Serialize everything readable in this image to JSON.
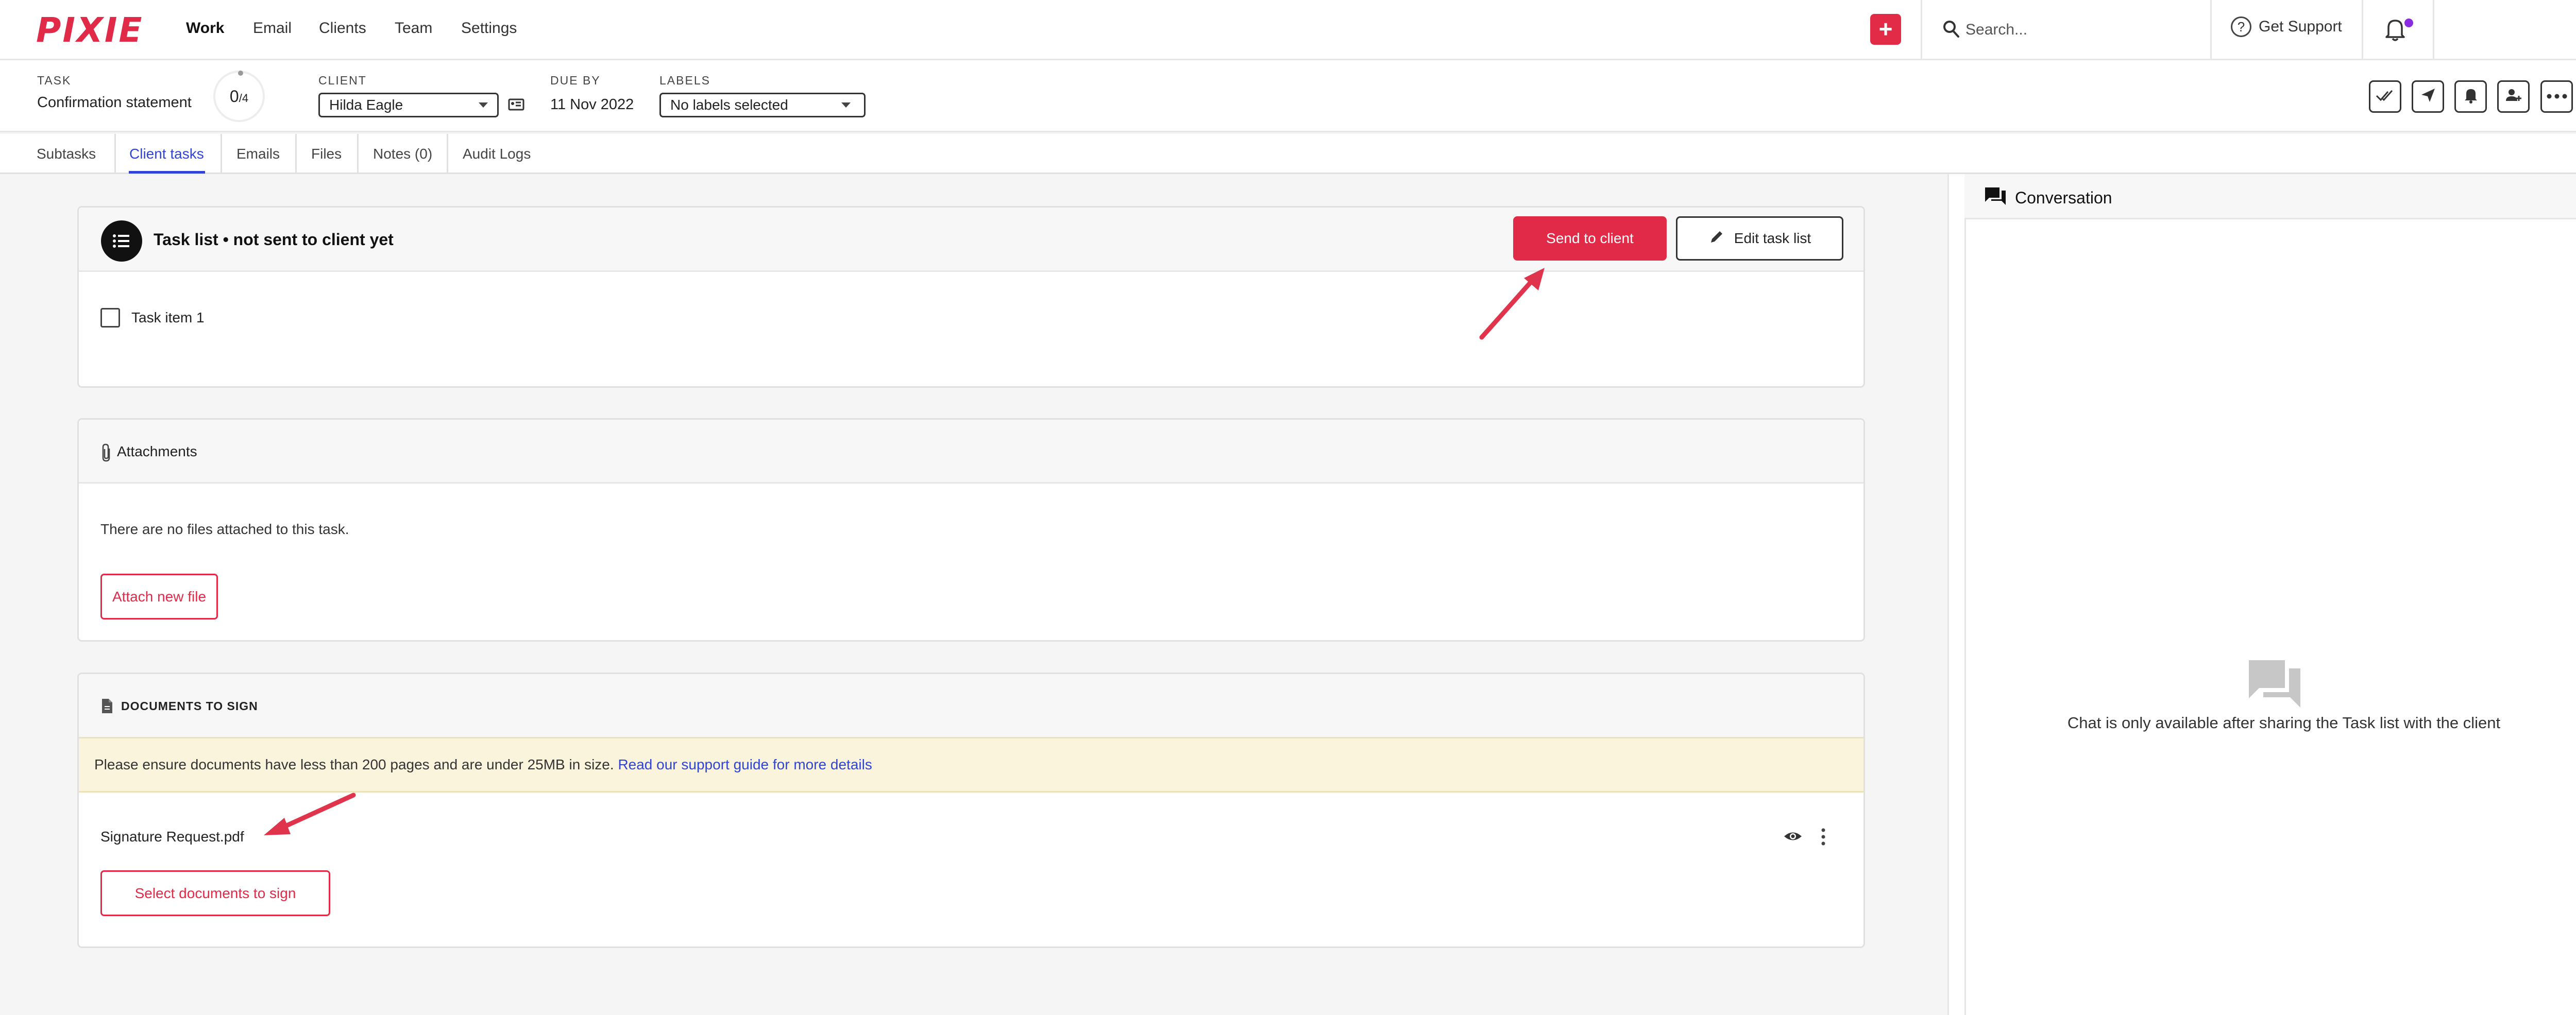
{
  "brand": {
    "logo_text": "PIXIE",
    "accent_color": "#e02a48",
    "link_color": "#2f43d9"
  },
  "topnav": {
    "links": [
      "Work",
      "Email",
      "Clients",
      "Team",
      "Settings"
    ],
    "active": "Work",
    "new_button_label": "+",
    "search": {
      "placeholder": "Search..."
    },
    "support_label": "Get Support",
    "notification_badge": true
  },
  "task_header": {
    "task_label": "TASK",
    "task_name": "Confirmation statement",
    "progress": {
      "done": "0",
      "total": "/4"
    },
    "client_label": "CLIENT",
    "client_value": "Hilda Eagle",
    "due_label": "DUE BY",
    "due_value": "11 Nov 2022",
    "labels_label": "LABELS",
    "labels_value": "No labels selected",
    "action_icons": [
      "double-check-icon",
      "send-icon",
      "bell-icon",
      "assign-user-icon",
      "more-icon"
    ]
  },
  "tabs": [
    {
      "label": "Subtasks"
    },
    {
      "label": "Client tasks"
    },
    {
      "label": "Emails"
    },
    {
      "label": "Files"
    },
    {
      "label": "Notes (0)"
    },
    {
      "label": "Audit Logs"
    }
  ],
  "active_tab": "Client tasks",
  "task_list": {
    "title": "Task list • not sent to client yet",
    "send_button": "Send to client",
    "edit_button": "Edit task list",
    "items": [
      {
        "label": "Task item 1",
        "checked": false
      }
    ]
  },
  "attachments": {
    "title": "Attachments",
    "empty_text": "There are no files attached to this task.",
    "attach_button": "Attach new file"
  },
  "documents": {
    "title": "DOCUMENTS TO SIGN",
    "notice_text": "Please ensure documents have less than 200 pages and are under 25MB in size.",
    "notice_link": "Read our support guide for more details",
    "files": [
      {
        "name": "Signature Request.pdf"
      }
    ],
    "select_button": "Select documents to sign"
  },
  "conversation": {
    "title": "Conversation",
    "empty_text": "Chat is only available after sharing the Task list with the client"
  },
  "annotations": {
    "arrow_color": "#e02a48"
  }
}
